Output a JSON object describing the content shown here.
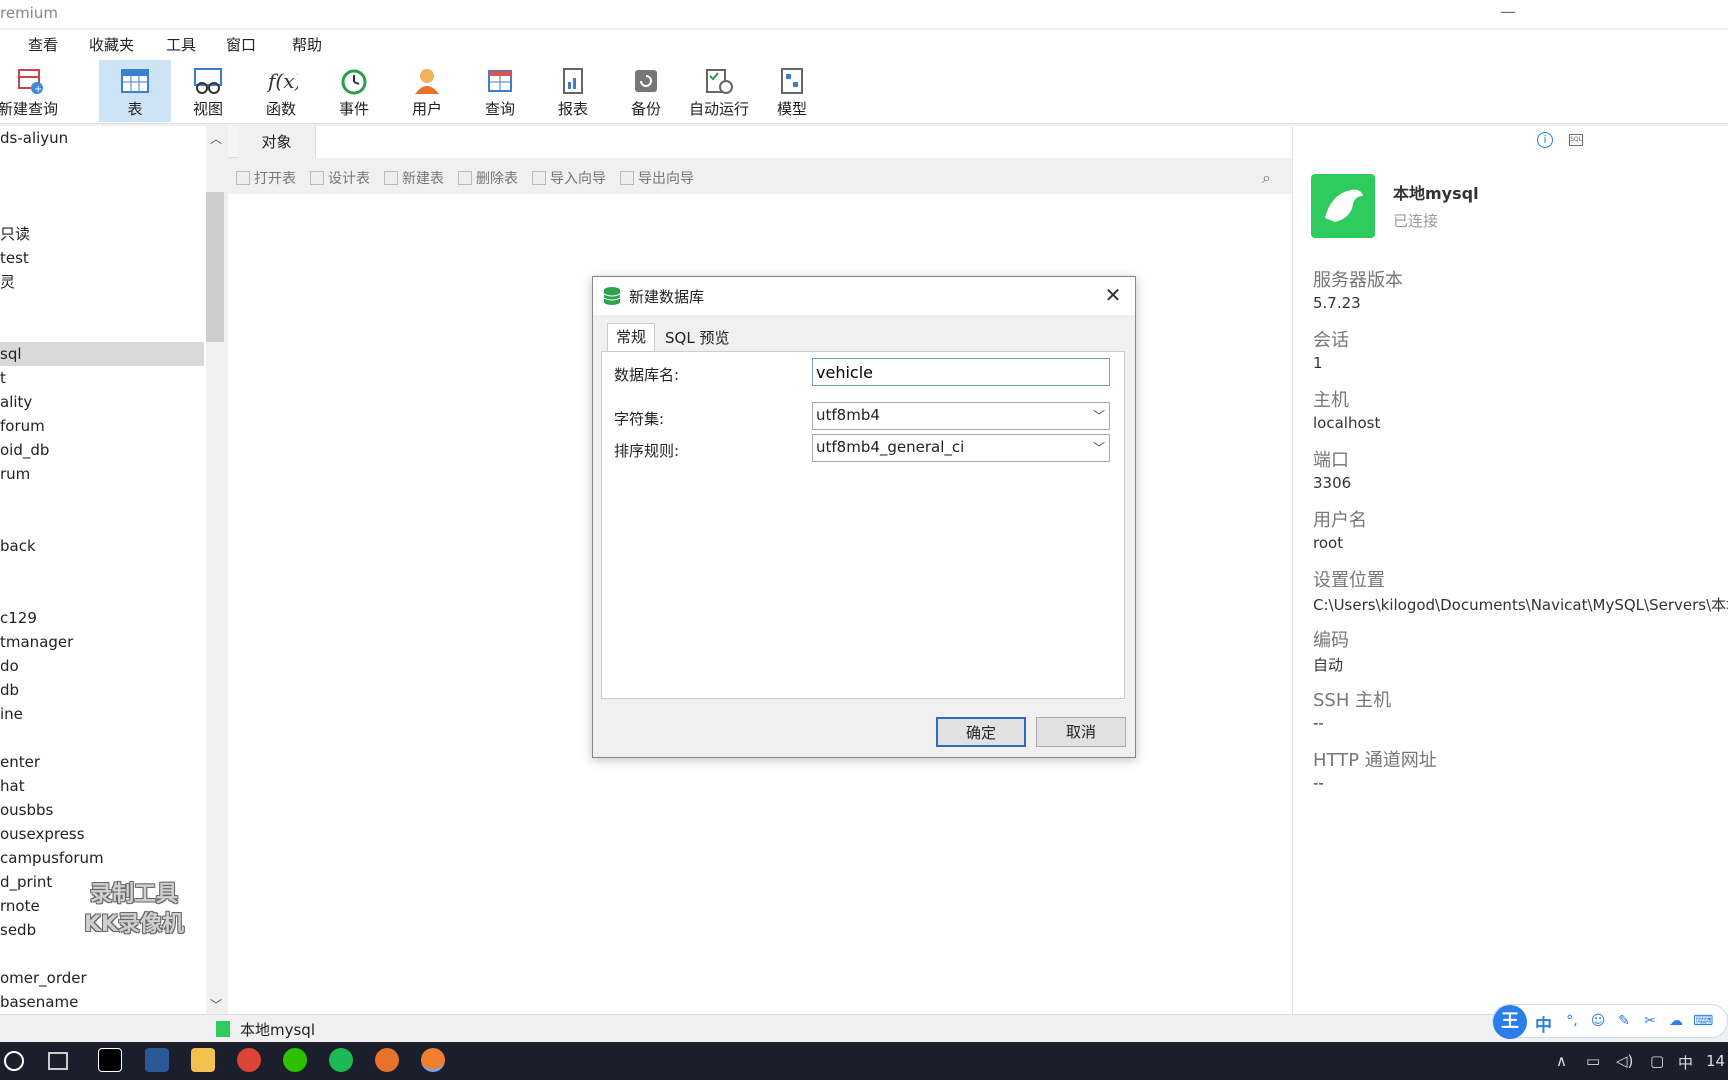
{
  "window": {
    "title": "remium",
    "minimize": "—"
  },
  "menu": [
    "查看",
    "收藏夹",
    "工具",
    "窗口",
    "帮助"
  ],
  "toolbar": [
    {
      "label": "新建查询",
      "icon": "new-query-icon"
    },
    {
      "label": "表",
      "icon": "table-icon",
      "active": true
    },
    {
      "label": "视图",
      "icon": "view-icon"
    },
    {
      "label": "函数",
      "icon": "function-icon"
    },
    {
      "label": "事件",
      "icon": "event-clock-icon"
    },
    {
      "label": "用户",
      "icon": "user-icon"
    },
    {
      "label": "查询",
      "icon": "query-icon"
    },
    {
      "label": "报表",
      "icon": "report-icon"
    },
    {
      "label": "备份",
      "icon": "backup-icon"
    },
    {
      "label": "自动运行",
      "icon": "auto-run-icon"
    },
    {
      "label": "模型",
      "icon": "model-icon"
    }
  ],
  "sidebar": {
    "items": [
      "ds-aliyun",
      "只读",
      "test",
      "灵",
      "sql",
      "t",
      "ality",
      "forum",
      "oid_db",
      "rum",
      "back",
      "c129",
      "tmanager",
      "do",
      "db",
      "ine",
      "enter",
      "hat",
      "ousbbs",
      "ousexpress",
      "campusforum",
      "d_print",
      "rnote",
      "sedb",
      "omer_order",
      "basename"
    ],
    "selected": "sql"
  },
  "tabs": {
    "objects": "对象"
  },
  "actions": [
    "打开表",
    "设计表",
    "新建表",
    "删除表",
    "导入向导",
    "导出向导"
  ],
  "info": {
    "connection_name": "本地mysql",
    "connection_status": "已连接",
    "fields": [
      {
        "label": "服务器版本",
        "value": "5.7.23"
      },
      {
        "label": "会话",
        "value": "1"
      },
      {
        "label": "主机",
        "value": "localhost"
      },
      {
        "label": "端口",
        "value": "3306"
      },
      {
        "label": "用户名",
        "value": "root"
      },
      {
        "label": "设置位置",
        "value": "C:\\Users\\kilogod\\Documents\\Navicat\\MySQL\\Servers\\本地"
      },
      {
        "label": "编码",
        "value": "自动"
      },
      {
        "label": "SSH 主机",
        "value": "--"
      },
      {
        "label": "HTTP 通道网址",
        "value": "--"
      }
    ]
  },
  "dialog": {
    "title": "新建数据库",
    "tab_general": "常规",
    "tab_sql": "SQL 预览",
    "name_label": "数据库名:",
    "name_value": "vehicle",
    "charset_label": "字符集:",
    "charset_value": "utf8mb4",
    "collation_label": "排序规则:",
    "collation_value": "utf8mb4_general_ci",
    "ok": "确定",
    "cancel": "取消"
  },
  "statusbar": {
    "connection": "本地mysql"
  },
  "watermark": {
    "line1": "录制工具",
    "line2": "KK录像机"
  },
  "ime": {
    "logo": "王",
    "mode": "中"
  },
  "tray": {
    "lang": "中",
    "clock": "14"
  },
  "colors": {
    "accent": "#cde4f7",
    "brand_green": "#2ecc5e",
    "taskbar": "#1a1f2b"
  }
}
